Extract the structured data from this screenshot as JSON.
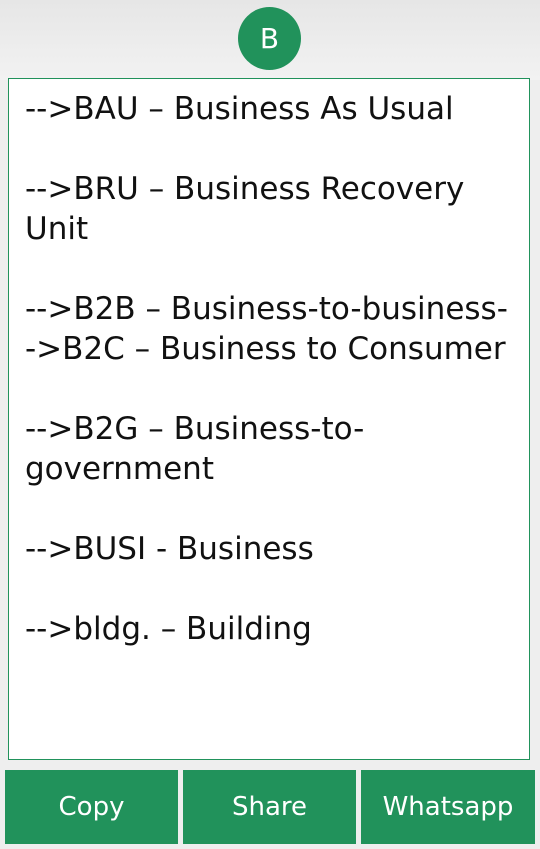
{
  "header": {
    "avatar_letter": "B"
  },
  "content": {
    "text": "-->BAU – Business As Usual\n\n-->BRU – Business Recovery Unit\n\n-->B2B – Business-to-business-->B2C – Business to Consumer\n\n-->B2G – Business-to-government\n\n-->BUSI - Business\n\n-->bldg. – Building"
  },
  "actions": {
    "copy_label": "Copy",
    "share_label": "Share",
    "whatsapp_label": "Whatsapp"
  },
  "colors": {
    "accent": "#21925b",
    "background": "#eeeeee",
    "text": "#111111"
  }
}
